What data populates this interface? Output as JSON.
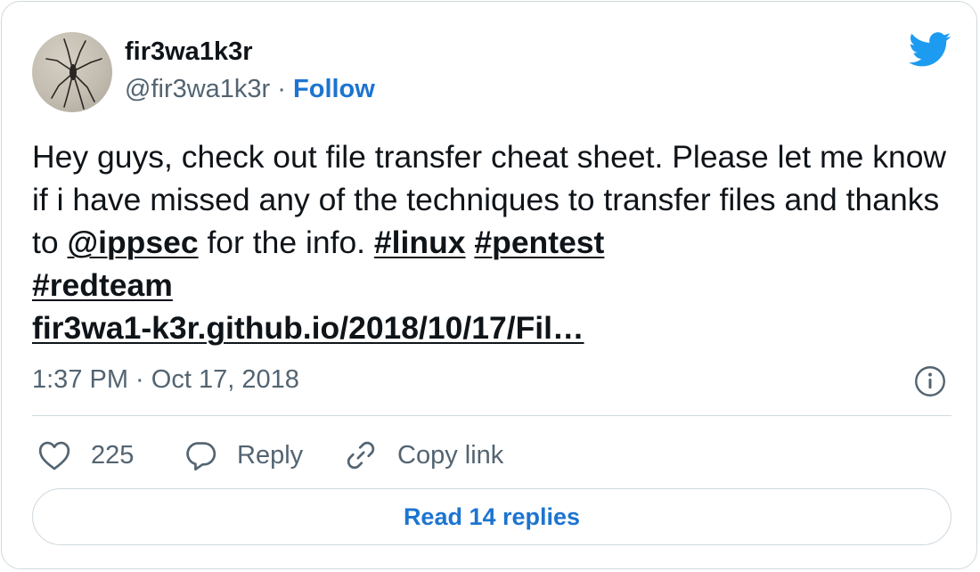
{
  "author": {
    "display_name": "fir3wa1k3r",
    "handle": "@fir3wa1k3r",
    "separator": "·",
    "follow_label": "Follow"
  },
  "tweet": {
    "text_part1": "Hey guys, check out file transfer cheat sheet. Please let me know if i have missed any of the techniques to transfer files and thanks to ",
    "mention": "@ippsec",
    "text_part2": " for the info. ",
    "hashtags": [
      "#linux",
      "#pentest",
      "#redteam"
    ],
    "link": "fir3wa1-k3r.github.io/2018/10/17/Fil…"
  },
  "meta": {
    "timestamp": "1:37 PM · Oct 17, 2018"
  },
  "actions": {
    "like_count": "225",
    "reply_label": "Reply",
    "copy_link_label": "Copy link"
  },
  "replies_button": {
    "label": "Read 14 replies"
  },
  "colors": {
    "accent": "#1d74d0",
    "twitter_blue": "#1d9bf0",
    "text": "#0f1419",
    "muted": "#536471",
    "border": "#cfd9de"
  },
  "icons": {
    "brand": "twitter-bird-icon",
    "info": "info-icon",
    "like": "heart-icon",
    "reply": "speech-bubble-icon",
    "copy_link": "link-icon"
  }
}
